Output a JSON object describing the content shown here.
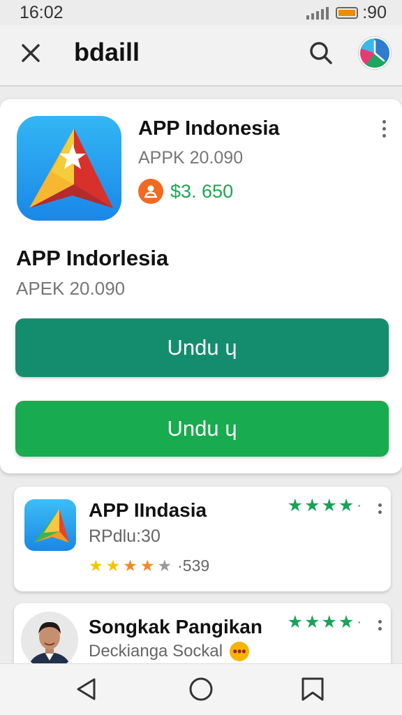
{
  "status_bar": {
    "time": "16:02",
    "battery": ":90"
  },
  "top_bar": {
    "title": "bdaill"
  },
  "main_card": {
    "title": "APP Indonesia",
    "subtitle": "APPK 20.090",
    "price": "$3. 650",
    "big_title": "APP Indorlesia",
    "big_subtitle": "APEK 20.090",
    "primary_button": "Undu ɥ",
    "secondary_button": "Undu ɥ"
  },
  "list": [
    {
      "title": "APP IIndasia",
      "subtitle": "RPdlu:30",
      "rating_count": "·539"
    },
    {
      "title": "Songkak Pangikan",
      "subtitle": "Deckianga Sockal"
    }
  ],
  "colors": {
    "primary_button": "#148d6f",
    "secondary_button": "#18ab4f",
    "price": "#1ea64f",
    "star_green": "#17a35a",
    "star_yellow": "#f5c400",
    "star_orange": "#f08a24"
  },
  "icons": [
    "close-icon",
    "search-icon",
    "profile-icon",
    "more-icon",
    "back-icon",
    "home-icon",
    "bookmark-icon"
  ]
}
